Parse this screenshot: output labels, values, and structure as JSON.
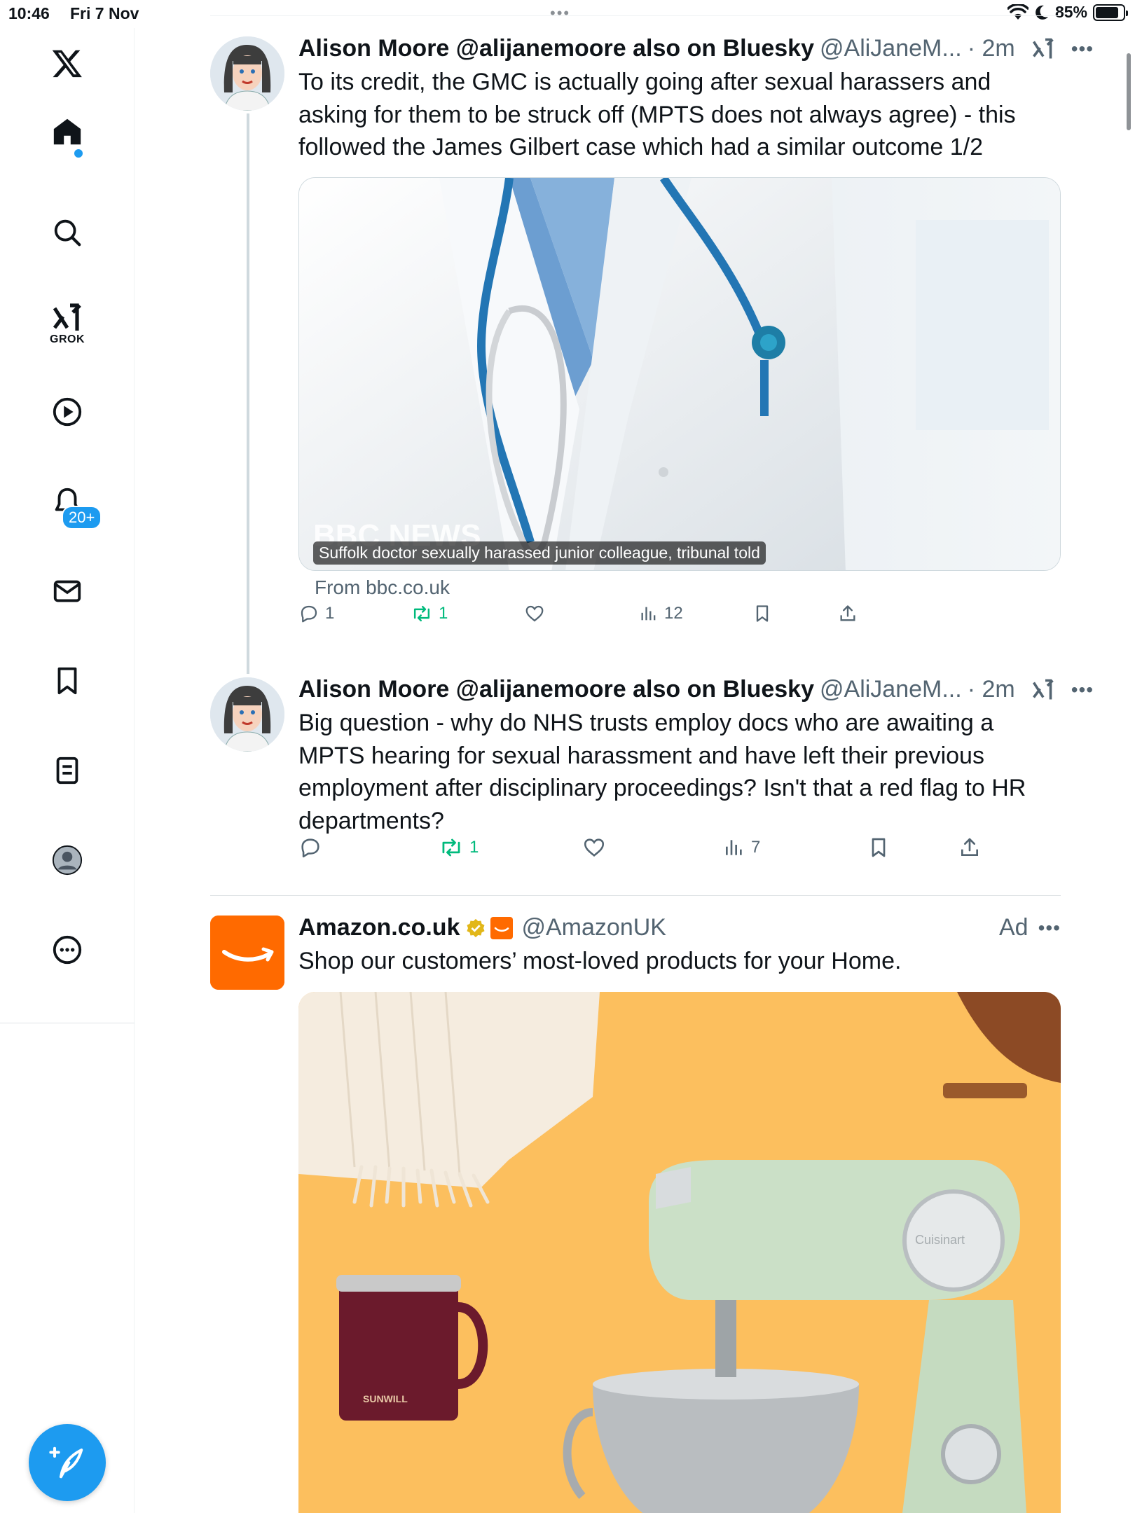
{
  "status_bar": {
    "time": "10:46",
    "date": "Fri 7 Nov",
    "battery": "85%",
    "battery_level": 0.85,
    "dots": "•••"
  },
  "sidebar": {
    "items": [
      {
        "name": "x-logo",
        "icon": "x-logo-icon"
      },
      {
        "name": "home",
        "icon": "home-icon"
      },
      {
        "name": "search",
        "icon": "search-icon"
      },
      {
        "name": "grok",
        "icon": "grok-icon",
        "label": "GROK"
      },
      {
        "name": "video",
        "icon": "play-icon"
      },
      {
        "name": "notifications",
        "icon": "bell-icon",
        "badge": "20+"
      },
      {
        "name": "messages",
        "icon": "mail-icon"
      },
      {
        "name": "bookmarks",
        "icon": "bookmark-icon"
      },
      {
        "name": "lists",
        "icon": "list-icon"
      },
      {
        "name": "profile",
        "icon": "profile-icon"
      },
      {
        "name": "more",
        "icon": "more-icon"
      }
    ],
    "compose_icon": "compose-icon"
  },
  "tweets": [
    {
      "display_name": "Alison Moore @alijanemoore also on Bluesky",
      "handle": "@AliJaneM...",
      "time": "· 2m",
      "text": "To its credit, the GMC is actually going after sexual harassers and asking for them to be struck off (MPTS does not always agree) - this followed the James Gilbert case which had a similar outcome 1/2",
      "card": {
        "caption": "Suffolk doctor sexually harassed junior colleague, tribunal told",
        "watermark": "BBC NEWS",
        "source": "From bbc.co.uk"
      },
      "actions": {
        "replies": "1",
        "retweets": "1",
        "likes": "",
        "views": "12"
      }
    },
    {
      "display_name": "Alison Moore @alijanemoore also on Bluesky",
      "handle": "@AliJaneM...",
      "time": "· 2m",
      "text": "Big question - why do NHS trusts employ docs who are awaiting a MPTS hearing for sexual harassment and have left their previous employment after disciplinary proceedings? Isn't that a red flag to HR departments?",
      "actions": {
        "replies": "",
        "retweets": "1",
        "likes": "",
        "views": "7"
      }
    },
    {
      "display_name": "Amazon.co.uk",
      "handle": "@AmazonUK",
      "ad_label": "Ad",
      "text": "Shop our customers’ most-loved products for your Home.",
      "image": {
        "mug_text": "SUNWILL",
        "mixer_text": "Cuisinart"
      }
    }
  ],
  "colors": {
    "accent": "#1d9bf0",
    "retweet": "#00ba7c",
    "secondary_text": "#536471",
    "amazon_orange": "#ff6a00",
    "ad_background": "#fcbf5e",
    "verified_gold": "#e2b719"
  }
}
